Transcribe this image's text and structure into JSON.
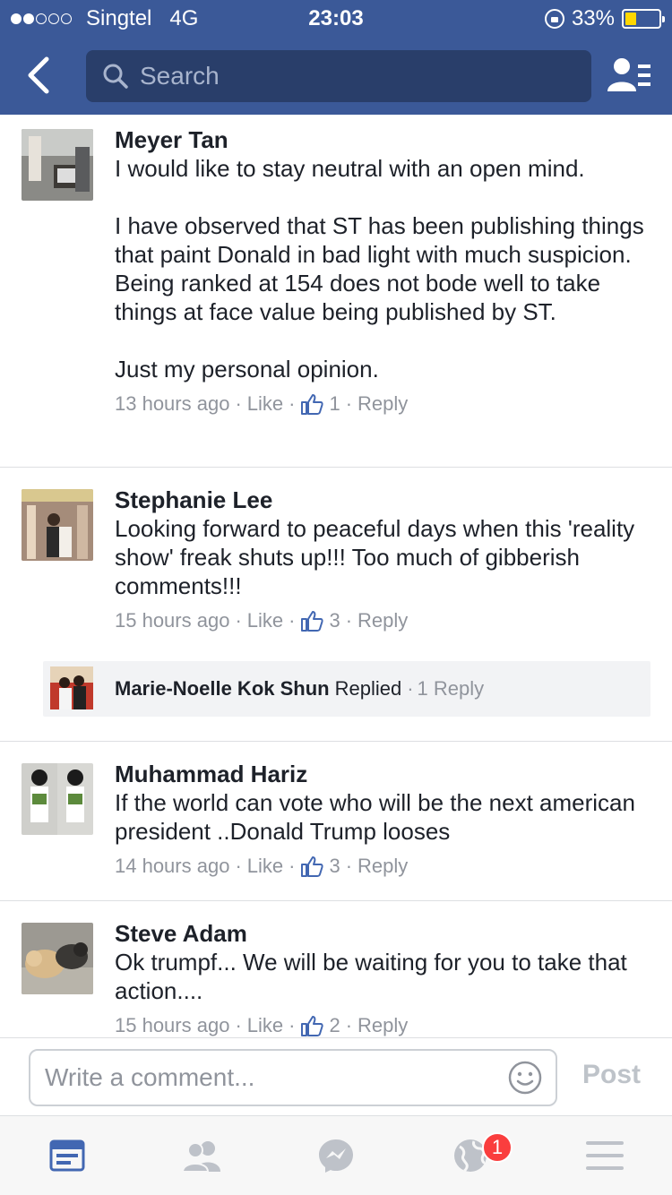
{
  "status_bar": {
    "carrier": "Singtel",
    "network": "4G",
    "time": "23:03",
    "battery": "33%",
    "battery_level": 0.33
  },
  "nav": {
    "search_placeholder": "Search"
  },
  "comments": [
    {
      "name": "Meyer Tan",
      "text": "I would like to stay neutral with an open mind.\n\nI have observed that ST has been publishing things that paint Donald in bad light with much suspicion.  Being ranked at 154 does not bode well to take things at face value being published by ST.\n\nJust my personal opinion.",
      "time": "13 hours ago",
      "like_label": "Like",
      "likes": "1",
      "reply_label": "Reply"
    },
    {
      "name": "Stephanie Lee",
      "text": "Looking forward to peaceful days when this 'reality show' freak shuts up!!! Too much of gibberish comments!!!",
      "time": "15 hours ago",
      "like_label": "Like",
      "likes": "3",
      "reply_label": "Reply",
      "reply_summary": {
        "name": "Marie-Noelle Kok Shun",
        "action": "Replied",
        "count": "1 Reply"
      }
    },
    {
      "name": "Muhammad Hariz",
      "text": "If the world can vote who will be the next american president ..Donald Trump looses",
      "time": "14 hours ago",
      "like_label": "Like",
      "likes": "3",
      "reply_label": "Reply"
    },
    {
      "name": "Steve Adam",
      "text": "Ok trumpf... We will be waiting for you to take that action....",
      "time": "15 hours ago",
      "like_label": "Like",
      "likes": "2",
      "reply_label": "Reply"
    }
  ],
  "composer": {
    "placeholder": "Write a comment...",
    "post_label": "Post"
  },
  "tabbar": {
    "notifications_badge": "1",
    "active_color": "#4267b2",
    "inactive_color": "#bec2c9"
  }
}
